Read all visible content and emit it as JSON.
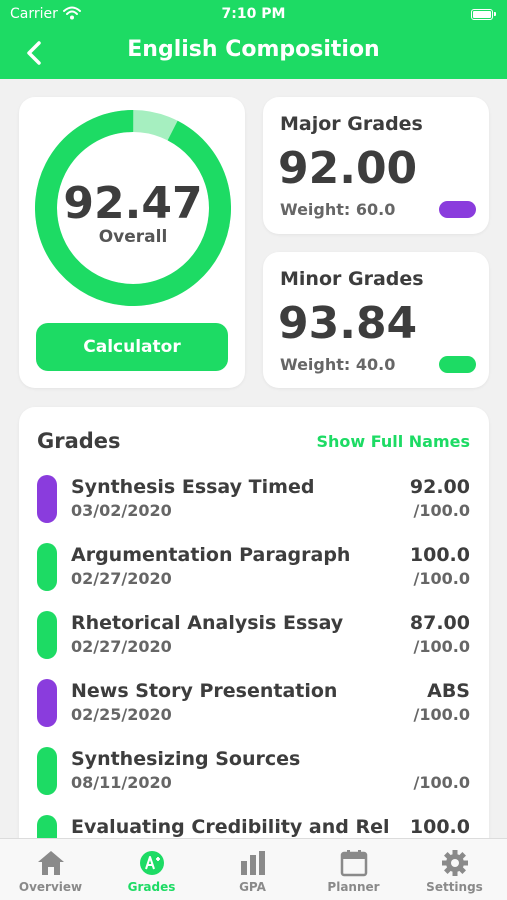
{
  "status_bar": {
    "carrier": "Carrier",
    "time": "7:10 PM"
  },
  "nav": {
    "title": "English Composition"
  },
  "overall": {
    "value": "92.47",
    "label": "Overall",
    "progress_fraction": 0.9247,
    "calculator_label": "Calculator"
  },
  "major": {
    "title": "Major Grades",
    "value": "92.00",
    "weight": "Weight: 60.0",
    "color": "#8a3cdd"
  },
  "minor": {
    "title": "Minor Grades",
    "value": "93.84",
    "weight": "Weight: 40.0",
    "color": "#1ddb64"
  },
  "grades": {
    "header": "Grades",
    "show_full_label": "Show Full Names",
    "items": [
      {
        "name": "Synthesis Essay Timed",
        "date": "03/02/2020",
        "score": "92.00",
        "max": "/100.0",
        "color": "#8a3cdd"
      },
      {
        "name": "Argumentation Paragraph",
        "date": "02/27/2020",
        "score": "100.0",
        "max": "/100.0",
        "color": "#1ddb64"
      },
      {
        "name": "Rhetorical Analysis Essay",
        "date": "02/27/2020",
        "score": "87.00",
        "max": "/100.0",
        "color": "#1ddb64"
      },
      {
        "name": "News Story Presentation",
        "date": "02/25/2020",
        "score": "ABS",
        "max": "/100.0",
        "color": "#8a3cdd"
      },
      {
        "name": "Synthesizing Sources",
        "date": "08/11/2020",
        "score": "",
        "max": "/100.0",
        "color": "#1ddb64"
      },
      {
        "name": "Evaluating Credibility and Reli",
        "date": "",
        "score": "100.0",
        "max": "",
        "color": "#1ddb64"
      }
    ]
  },
  "tabs": [
    {
      "label": "Overview",
      "icon": "house-icon"
    },
    {
      "label": "Grades",
      "icon": "grade-badge-icon"
    },
    {
      "label": "GPA",
      "icon": "bar-chart-icon"
    },
    {
      "label": "Planner",
      "icon": "calendar-icon"
    },
    {
      "label": "Settings",
      "icon": "gear-icon"
    }
  ],
  "colors": {
    "accent": "#1ddb64",
    "major": "#8a3cdd",
    "ring_remaining": "#a6efc0",
    "background": "#f1f1f1"
  }
}
